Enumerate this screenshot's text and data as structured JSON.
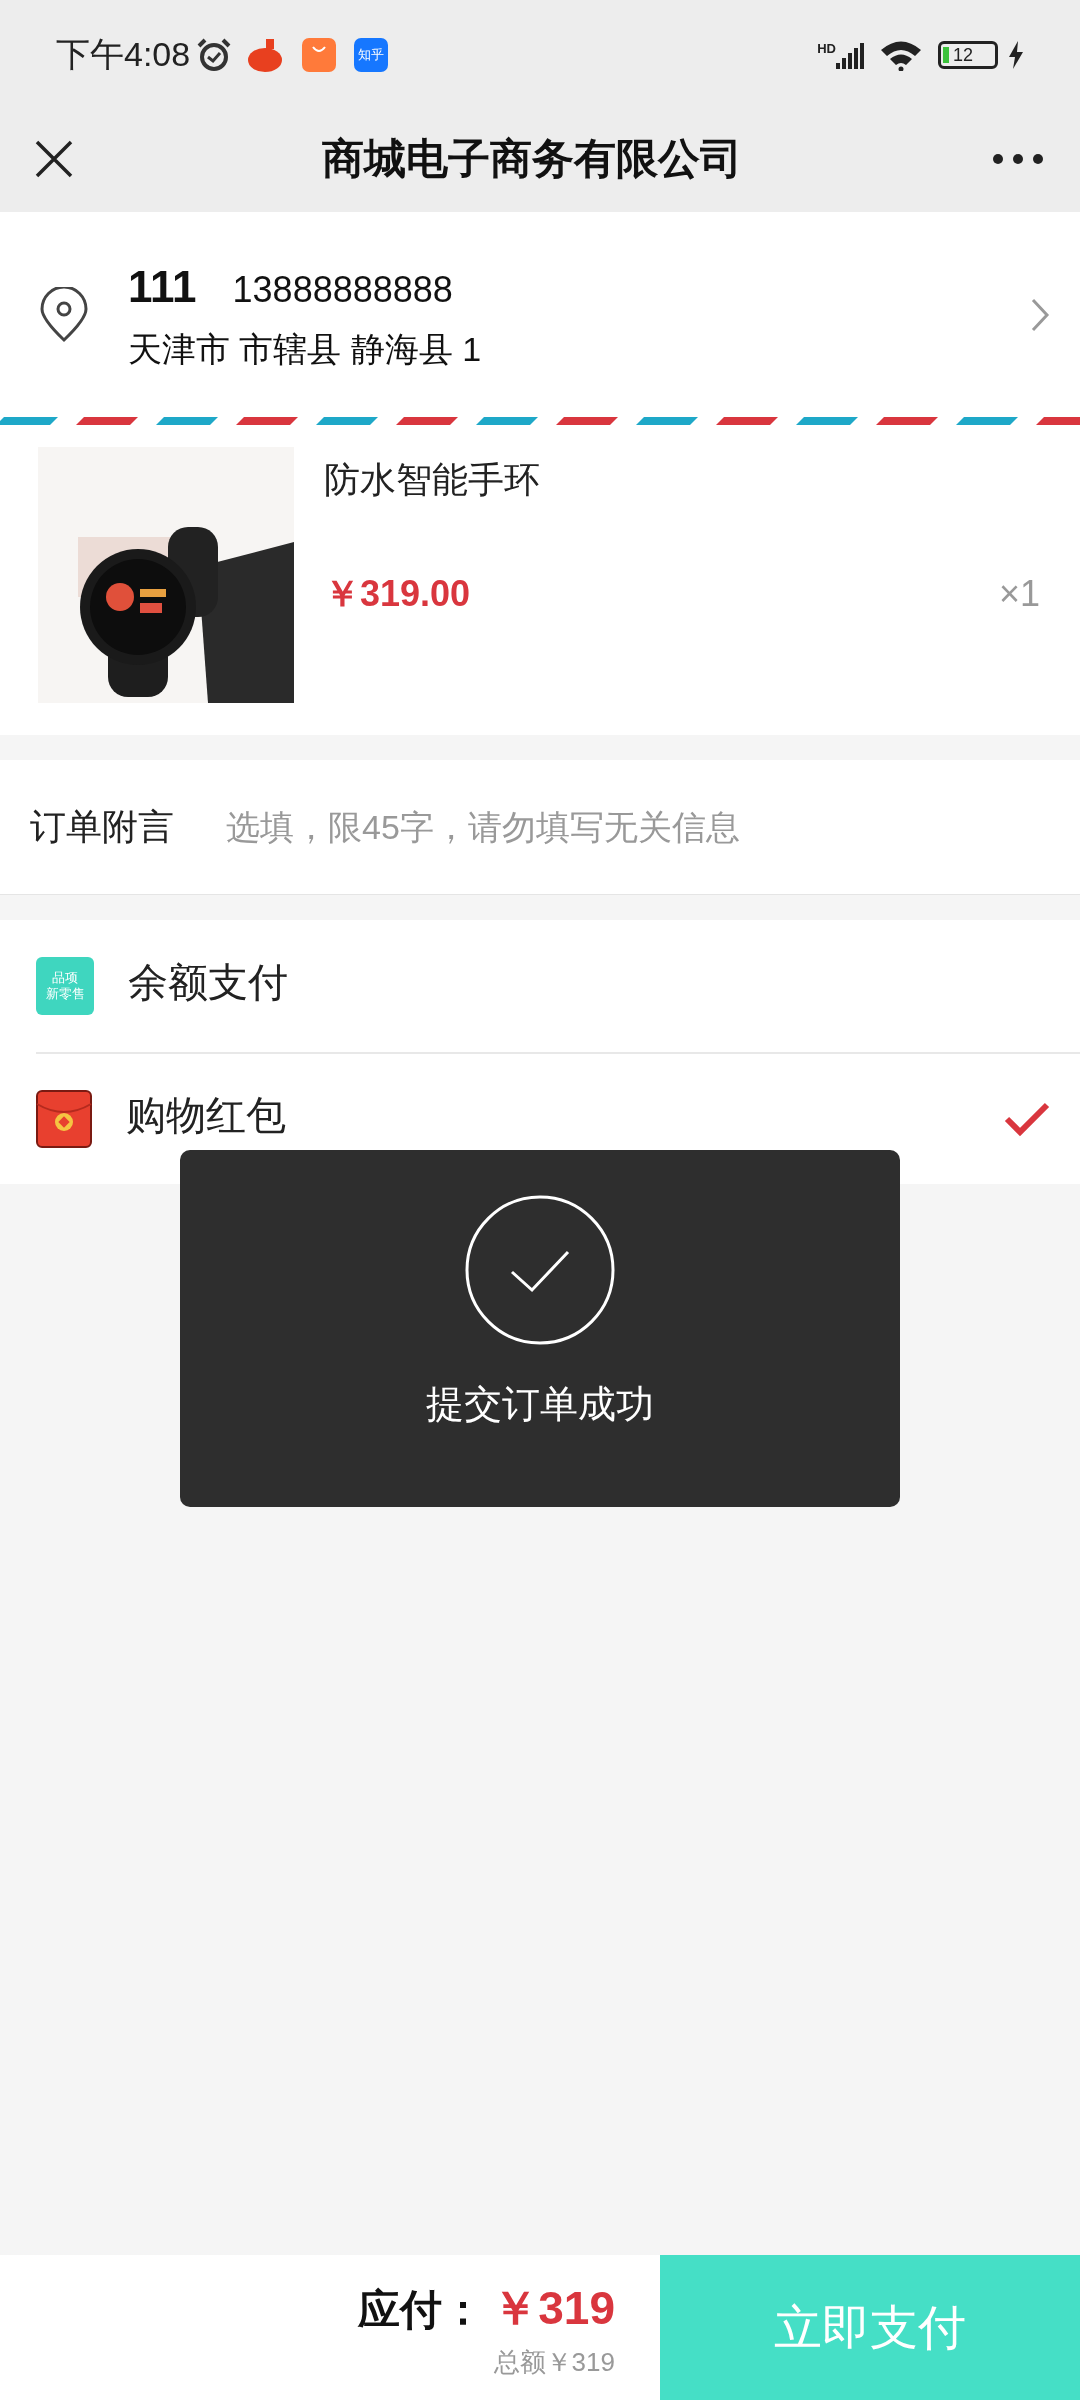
{
  "status_bar": {
    "time": "下午4:08",
    "app_badge": "知乎",
    "network": "HD",
    "battery": "12"
  },
  "nav": {
    "title": "商城电子商务有限公司"
  },
  "address": {
    "name": "111",
    "phone": "13888888888",
    "detail": "天津市 市辖县 静海县 1"
  },
  "product": {
    "name": "防水智能手环",
    "price": "￥319.00",
    "quantity": "×1"
  },
  "note": {
    "label": "订单附言",
    "placeholder": "选填，限45字，请勿填写无关信息"
  },
  "payments": [
    {
      "kind": "balance",
      "label": "余额支付",
      "icon_lines": [
        "品项",
        "新零售"
      ],
      "selected": false
    },
    {
      "kind": "redpacket",
      "label": "购物红包",
      "selected": true
    }
  ],
  "toast": {
    "message": "提交订单成功"
  },
  "footer": {
    "due_label": "应付：",
    "due_amount": "￥319",
    "total": "总额￥319",
    "pay_button": "立即支付"
  }
}
